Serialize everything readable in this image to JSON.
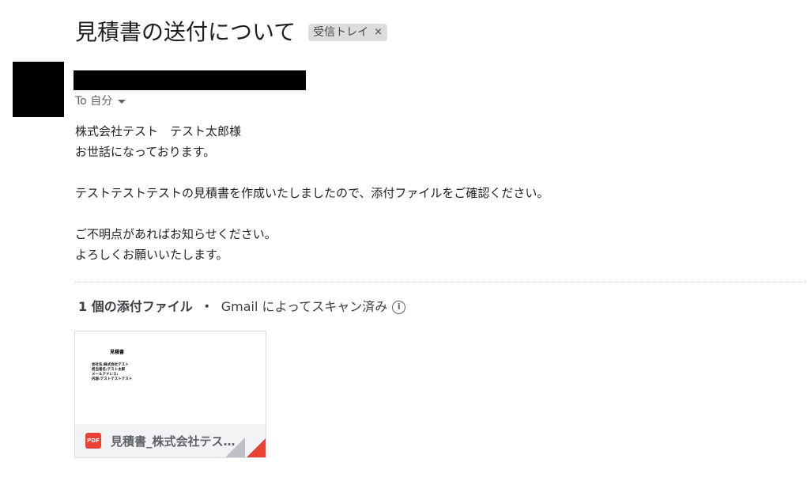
{
  "subject": "見積書の送付について",
  "label": {
    "name": "受信トレイ",
    "close": "×"
  },
  "sender": {
    "avatar": "sender-avatar",
    "name": ""
  },
  "recipient": {
    "text": "To 自分",
    "caret": "caret-down-icon"
  },
  "body": {
    "lines": [
      "株式会社テスト　テスト太郎様",
      "お世話になっております。",
      "",
      "テストテストテストの見積書を作成いたしましたので、添付ファイルをご確認ください。",
      "",
      "ご不明点があればお知らせください。",
      "よろしくお願いいたします。"
    ]
  },
  "attachments": {
    "count_label": "1 個の添付ファイル",
    "separator": "・",
    "scan_label": "Gmail によってスキャン済み",
    "info_icon": "i",
    "items": [
      {
        "type_badge": "PDF",
        "name": "見積書_株式会社テスト.pdf",
        "thumbnail": {
          "title": "見積書",
          "lines": [
            "会社名:株式会社テスト",
            "担当者名:テスト太郎",
            "メールアドレス:",
            "内容:テストテストテスト"
          ]
        }
      }
    ]
  },
  "colors": {
    "pdf_red": "#ea4335",
    "chip_bg": "#dddddd",
    "muted_text": "#5f6368"
  }
}
